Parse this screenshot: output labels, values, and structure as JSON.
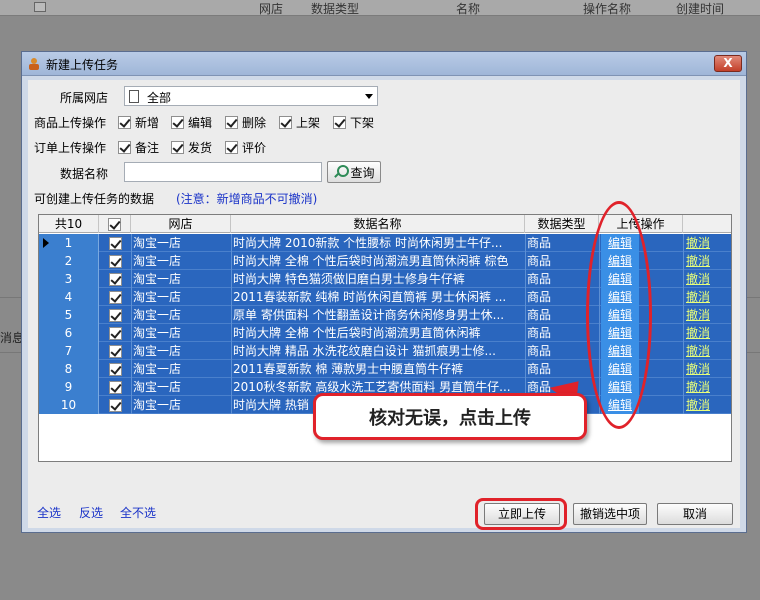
{
  "background_app": {
    "columns": [
      "网店",
      "数据类型",
      "名称",
      "操作名称",
      "创建时间"
    ],
    "left_fragment": "消息"
  },
  "dialog": {
    "title": "新建上传任务",
    "close_label": "X",
    "shop_label": "所属网店",
    "shop_value": "全部",
    "product_ops_label": "商品上传操作",
    "product_ops": [
      "新增",
      "编辑",
      "删除",
      "上架",
      "下架"
    ],
    "order_ops_label": "订单上传操作",
    "order_ops": [
      "备注",
      "发货",
      "评价"
    ],
    "data_name_label": "数据名称",
    "data_name_value": "",
    "query_label": "查询",
    "available_label": "可创建上传任务的数据",
    "note": "(注意：新增商品不可撤消)",
    "grid": {
      "headers": [
        "共10",
        "",
        "网店",
        "数据名称",
        "数据类型",
        "上传操作",
        ""
      ],
      "rows": [
        {
          "index": "1",
          "shop": "淘宝一店",
          "name": "时尚大牌 2010新款 个性腰标 时尚休闲男士牛仔...",
          "type": "商品",
          "op": "编辑",
          "cancel": "撤消"
        },
        {
          "index": "2",
          "shop": "淘宝一店",
          "name": "时尚大牌 全棉 个性后袋时尚潮流男直筒休闲裤 棕色",
          "type": "商品",
          "op": "编辑",
          "cancel": "撤消"
        },
        {
          "index": "3",
          "shop": "淘宝一店",
          "name": "时尚大牌 特色猫须做旧磨白男士修身牛仔裤",
          "type": "商品",
          "op": "编辑",
          "cancel": "撤消"
        },
        {
          "index": "4",
          "shop": "淘宝一店",
          "name": "2011春装新款 纯棉 时尚休闲直筒裤 男士休闲裤 ...",
          "type": "商品",
          "op": "编辑",
          "cancel": "撤消"
        },
        {
          "index": "5",
          "shop": "淘宝一店",
          "name": "原单 寄供面料 个性翻盖设计商务休闲修身男士休...",
          "type": "商品",
          "op": "编辑",
          "cancel": "撤消"
        },
        {
          "index": "6",
          "shop": "淘宝一店",
          "name": "时尚大牌 全棉 个性后袋时尚潮流男直筒休闲裤",
          "type": "商品",
          "op": "编辑",
          "cancel": "撤消"
        },
        {
          "index": "7",
          "shop": "淘宝一店",
          "name": "时尚大牌 精品 水洗花纹磨白设计 猫抓痕男士修...",
          "type": "商品",
          "op": "编辑",
          "cancel": "撤消"
        },
        {
          "index": "8",
          "shop": "淘宝一店",
          "name": "2011春夏新款 棉 薄款男士中腰直筒牛仔裤",
          "type": "商品",
          "op": "编辑",
          "cancel": "撤消"
        },
        {
          "index": "9",
          "shop": "淘宝一店",
          "name": "2010秋冬新款 高级水洗工艺寄供面料 男直筒牛仔...",
          "type": "商品",
          "op": "编辑",
          "cancel": "撤消"
        },
        {
          "index": "10",
          "shop": "淘宝一店",
          "name": "时尚大牌 热销",
          "type": "商品",
          "op": "编辑",
          "cancel": "撤消"
        }
      ]
    },
    "callout": "核对无误，点击上传",
    "select_all": "全选",
    "invert_select": "反选",
    "select_none": "全不选",
    "upload_now": "立即上传",
    "cancel_selected": "撤销选中项",
    "cancel": "取消"
  },
  "colors": {
    "selection": "#2a66be",
    "highlight_red": "#e0222a",
    "link_blue": "#1a33c8"
  }
}
